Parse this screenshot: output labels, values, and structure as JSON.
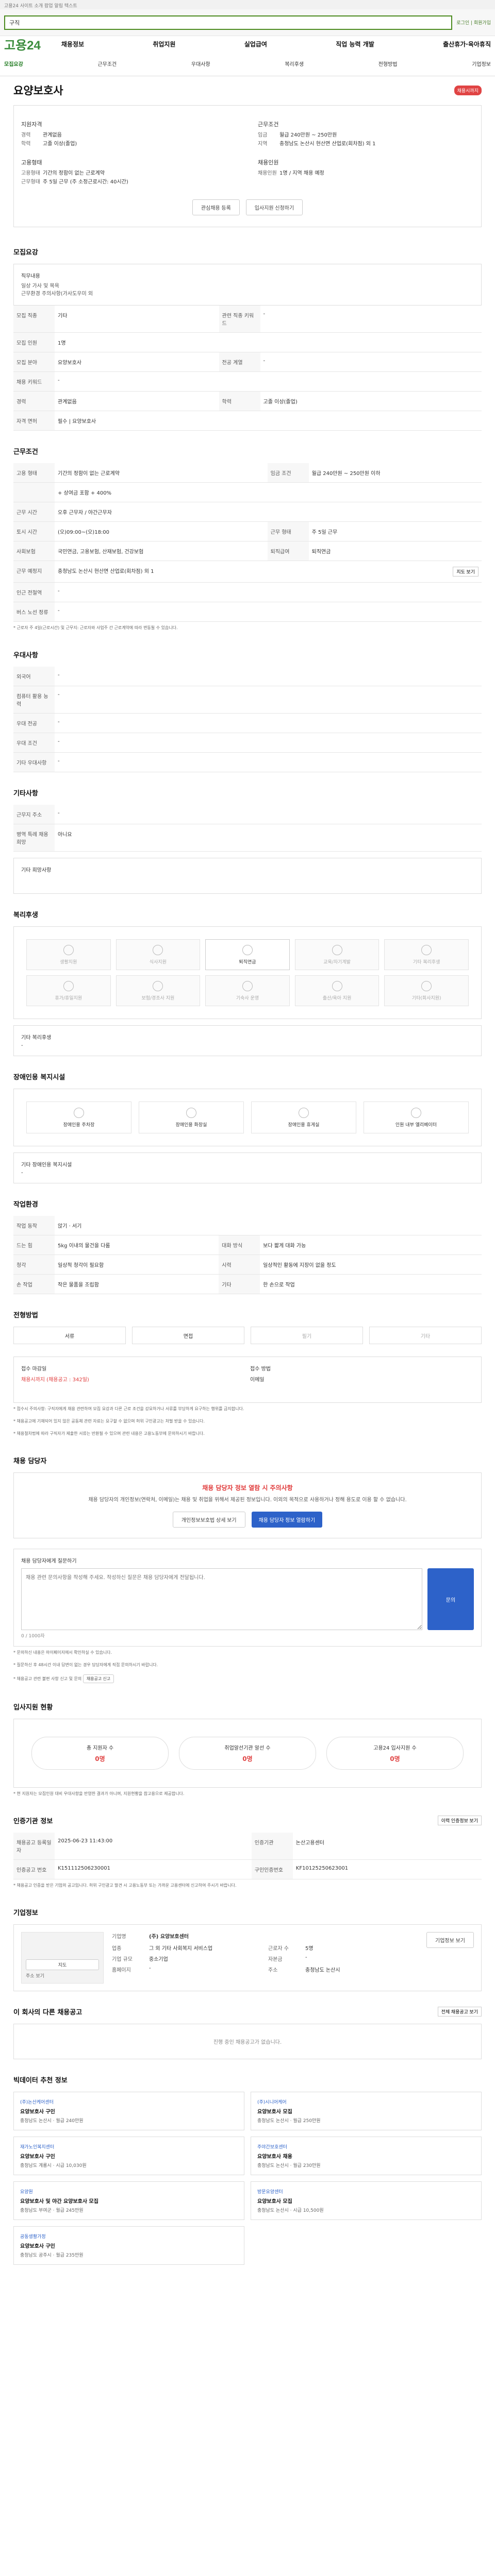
{
  "top_notice": "고용24 사이트 소개 팝업 알림 텍스트",
  "search": {
    "value": "구직",
    "login_links": "로그인 | 회원가입"
  },
  "brand": {
    "logo": "고용24"
  },
  "gnb": [
    "채용정보",
    "취업지원",
    "실업급여",
    "직업 능력 개발",
    "출산휴가·육아휴직"
  ],
  "subnav": [
    {
      "label": "모집요강",
      "active": true
    },
    {
      "label": "근무조건",
      "active": false
    },
    {
      "label": "우대사항",
      "active": false
    },
    {
      "label": "복리후생",
      "active": false
    },
    {
      "label": "전형방법",
      "active": false
    },
    {
      "label": "기업정보",
      "active": false
    }
  ],
  "job": {
    "title": "요양보호사",
    "status_badge": "채용시까지",
    "summary": {
      "left_heading1": "지원자격",
      "left_rows1": [
        {
          "k": "경력",
          "v": "관계없음"
        },
        {
          "k": "학력",
          "v": "고졸 이상(졸업)"
        }
      ],
      "right_heading1": "근무조건",
      "right_rows1": [
        {
          "k": "임금",
          "v": "월급 240만원 ~ 250만원"
        },
        {
          "k": "지역",
          "v": "충청남도 논산시 현산면 산업로(회차점) 외 1"
        }
      ],
      "left_heading2": "고용형태",
      "left_rows2": [
        {
          "k": "고용형태",
          "v": "기간의 정함이 없는 근로계약"
        },
        {
          "k": "근무형태",
          "v": "주 5일 근무 (주 소정근로시간: 40시간)"
        }
      ],
      "right_heading2": "채용인원",
      "right_rows2": [
        {
          "k": "채용인원",
          "v": "1명 / 지역 채용 예정"
        }
      ],
      "btn_save": "관심채용 등록",
      "btn_apply": "입사지원 신청하기"
    }
  },
  "recruit": {
    "heading": "모집요강",
    "duty_label": "직무내용",
    "duty_text": "일상 가사 및 목욕\n근무환경 주의사항(가사도우미 외",
    "rows": [
      [
        "모집 직종",
        "기타",
        "관련 직종 키워드",
        "-"
      ],
      [
        "모집 인원",
        "1명",
        "",
        ""
      ],
      [
        "모집 분야",
        "요양보호사",
        "전공 계열",
        "-"
      ],
      [
        "채용 키워드",
        "-",
        "",
        ""
      ],
      [
        "경력",
        "관계없음",
        "학력",
        "고졸 이상(졸업)"
      ],
      [
        "자격 면허",
        "필수 | 요양보호사",
        "",
        ""
      ]
    ]
  },
  "conditions": {
    "heading": "근무조건",
    "rows": [
      [
        "고용 형태",
        "기간의 정함이 없는 근로계약",
        "임금 조건",
        "월급 240만원 ~ 250만원 이하"
      ],
      [
        "",
        "+ 상여금 포함 + 400%",
        "",
        ""
      ],
      [
        "근무 시간",
        "오후 근무자 / 야간근무자",
        "",
        ""
      ],
      [
        "토시 시간",
        "(오)09:00~(오)18:00",
        "근무 형태",
        "주 5일 근무"
      ],
      [
        "사회보험",
        "국민연금, 고용보험, 산재보험, 건강보험",
        "퇴직급여",
        "퇴직연금"
      ],
      [
        "근무 예정지",
        "충청남도 논산시 현산면 산업로(회차점) 외 1",
        "",
        ""
      ],
      [
        "인근 전철역",
        "-",
        "",
        ""
      ],
      [
        "버스 노선 정류",
        "-",
        "",
        ""
      ]
    ],
    "map_button": "지도 보기",
    "note": "* 근로자 주 4일(근로시간) 및 근무지: 근로자와 사업주 간 근로계약에 따라 변동될 수 있습니다."
  },
  "preferences": {
    "heading": "우대사항",
    "rows": [
      [
        "외국어",
        "-"
      ],
      [
        "컴퓨터 활용 능력",
        "-"
      ],
      [
        "우대 전공",
        "-"
      ],
      [
        "우대 조건",
        "-"
      ],
      [
        "기타 우대사항",
        "-"
      ]
    ]
  },
  "other_conditions": {
    "heading": "기타사항",
    "rows": [
      [
        "근무지 주소",
        "-"
      ],
      [
        "병역 특례 채용 희망",
        "아니요"
      ]
    ],
    "extra_label": "기타 희망사항"
  },
  "welfare": {
    "heading": "복리후생",
    "items": [
      {
        "label": "생활지원",
        "on": false
      },
      {
        "label": "식사지원",
        "on": false
      },
      {
        "label": "퇴직연금",
        "on": true
      },
      {
        "label": "교육/자기계발",
        "on": false
      },
      {
        "label": "기타 복리후생",
        "on": false
      },
      {
        "label": "휴가/휴일지원",
        "on": false
      },
      {
        "label": "보험/경조사 지원",
        "on": false
      },
      {
        "label": "기숙사 운영",
        "on": false
      },
      {
        "label": "출산/육아 지원",
        "on": false
      },
      {
        "label": "기타(회사지원)",
        "on": false
      }
    ],
    "extra_label": "기타 복리후생",
    "extra_value": "-"
  },
  "disability": {
    "heading": "장애인용 복지시설",
    "items": [
      "장애인용 주차장",
      "장애인용 화장실",
      "장애인용 휴게실",
      "인원 내부 엘리베이터"
    ],
    "extra_label": "기타 장애인용 복지시설",
    "extra_value": "-"
  },
  "work_env": {
    "heading": "작업환경",
    "rows": [
      [
        "작업 동작",
        "앉기 · 서기",
        "",
        ""
      ],
      [
        "드는 힘",
        "5kg 이내의 물건을 다룸",
        "대화 방식",
        "보다 짧게 대화 가능"
      ],
      [
        "청각",
        "일상적 청각이 필요함",
        "시력",
        "일상적인 활동에 지장이 없을 정도"
      ],
      [
        "손 작업",
        "작은 물품을 조립함",
        "기타",
        "한 손으로 작업"
      ]
    ]
  },
  "process": {
    "heading": "전형방법",
    "tabs": [
      {
        "label": "서류",
        "on": true
      },
      {
        "label": "면접",
        "on": true
      },
      {
        "label": "필기",
        "on": false
      },
      {
        "label": "기타",
        "on": false
      }
    ],
    "deadline_label": "접수 마감일",
    "deadline_value": "채용시까지 (채용공고 : 342일)",
    "method_label": "접수 방법",
    "method_value": "이메일",
    "notes": [
      "* 접수시 주의사항: 구직자에게 채용 관련하여 모집 요강과 다른 근로 조건을 강요하거나 서류를 부당하게 요구하는 행위를 금지합니다.",
      "* 채용공고에 기재되어 있지 않은 공동체 관련 자료는 요구할 수 없으며 허위 구인광고는 처벌 받을 수 있습니다.",
      "* 채용절차법에 따라 구직자가 제출한 서류는 반환될 수 있으며 관련 내용은 고용노동부에 문의하시기 바랍니다."
    ]
  },
  "contact": {
    "heading": "채용 담당자",
    "alert_title": "채용 담당자 정보 열람 시 주의사항",
    "alert_text": "채용 담당자의 개인정보(연락처, 이메일)는 채용 및 취업을 위해서 제공된 정보입니다. 이외의 목적으로 사용하거나 정해 용도로 이용 할 수 없습니다.",
    "btn_check": "개인정보보호법 상세 보기",
    "btn_view": "채용 담당자 정보 열람하기",
    "inquiry_label": "채용 담당자에게 질문하기",
    "inquiry_placeholder": "채용 관련 문의사항을 작성해 주세요. 작성하신 질문은 채용 담당자에게 전달됩니다.",
    "inquiry_count": "0 / 1000자",
    "inquiry_submit": "문의",
    "notes": [
      "* 문의하신 내용은 마이페이지에서 확인하실 수 있습니다.",
      "* 질문하신 후 48시간 이내 답변이 없는 경우 담당자에게 직접 문의하시기 바랍니다.",
      "* 채용공고 관련 불편 사항 신고 및 문의"
    ],
    "report_button": "채용공고 신고"
  },
  "applicants": {
    "heading": "입사지원 현황",
    "stats": [
      {
        "label": "총 지원자 수",
        "value": "0명"
      },
      {
        "label": "취업알선기관 알선 수",
        "value": "0명"
      },
      {
        "label": "고용24 입사지원 수",
        "value": "0명"
      }
    ],
    "note": "* 현 지원자는 모집인원 대비 우대사항을 반영한 결과가 아니며, 지원현황을 참고용으로 제공합니다."
  },
  "agency": {
    "heading": "인증기관 정보",
    "more_button": "이력 인증정보 보기",
    "rows": [
      [
        "채용공고 등록일자",
        "2025-06-23 11:43:00",
        "인증기관",
        "논산고용센터"
      ],
      [
        "인증공고 번호",
        "K151112506230001",
        "구인인증번호",
        "KF10125250623001"
      ]
    ],
    "note": "* 채용공고 인증을 받은 기업의 공고입니다. 허위 구인광고 발견 시 고용노동부 또는 가까운 고용센터에 신고하여 주시기 바랍니다."
  },
  "company": {
    "heading": "기업정보",
    "name_label": "기업명",
    "name_value": "(주) 요양보호센터",
    "rows": [
      [
        "업종",
        "그 외 기타 사회복지 서비스업",
        "근로자 수",
        "5명"
      ],
      [
        "기업 규모",
        "중소기업",
        "자본금",
        "-"
      ],
      [
        "홈페이지",
        "-",
        "주소",
        "충청남도 논산시"
      ]
    ],
    "detail_button": "기업정보 보기",
    "map_button": "지도",
    "map_label": "주소 보기"
  },
  "related": {
    "heading": "이 회사의 다른 채용공고",
    "all_button": "전체 채용공고 보기",
    "empty": "진행 중인 채용공고가 없습니다."
  },
  "recommend": {
    "heading": "빅데이터 추천 정보",
    "cards": [
      {
        "company": "(주)논산케어센터",
        "title": "요양보호사 구인",
        "meta": "충청남도 논산시 · 월급 240만원"
      },
      {
        "company": "(주)시니어케어",
        "title": "요양보호사 모집",
        "meta": "충청남도 논산시 · 월급 250만원"
      },
      {
        "company": "재가노인복지센터",
        "title": "요양보호사 구인",
        "meta": "충청남도 계룡시 · 시급 10,030원"
      },
      {
        "company": "주야간보호센터",
        "title": "요양보호사 채용",
        "meta": "충청남도 논산시 · 월급 230만원"
      },
      {
        "company": "요양원",
        "title": "요양보호사 및 야간 요양보호사 모집",
        "meta": "충청남도 부여군 · 월급 245만원"
      },
      {
        "company": "방문요양센터",
        "title": "요양보호사 모집",
        "meta": "충청남도 논산시 · 시급 10,500원"
      },
      {
        "company": "공동생활가정",
        "title": "요양보호사 구인",
        "meta": "충청남도 공주시 · 월급 235만원"
      }
    ]
  }
}
